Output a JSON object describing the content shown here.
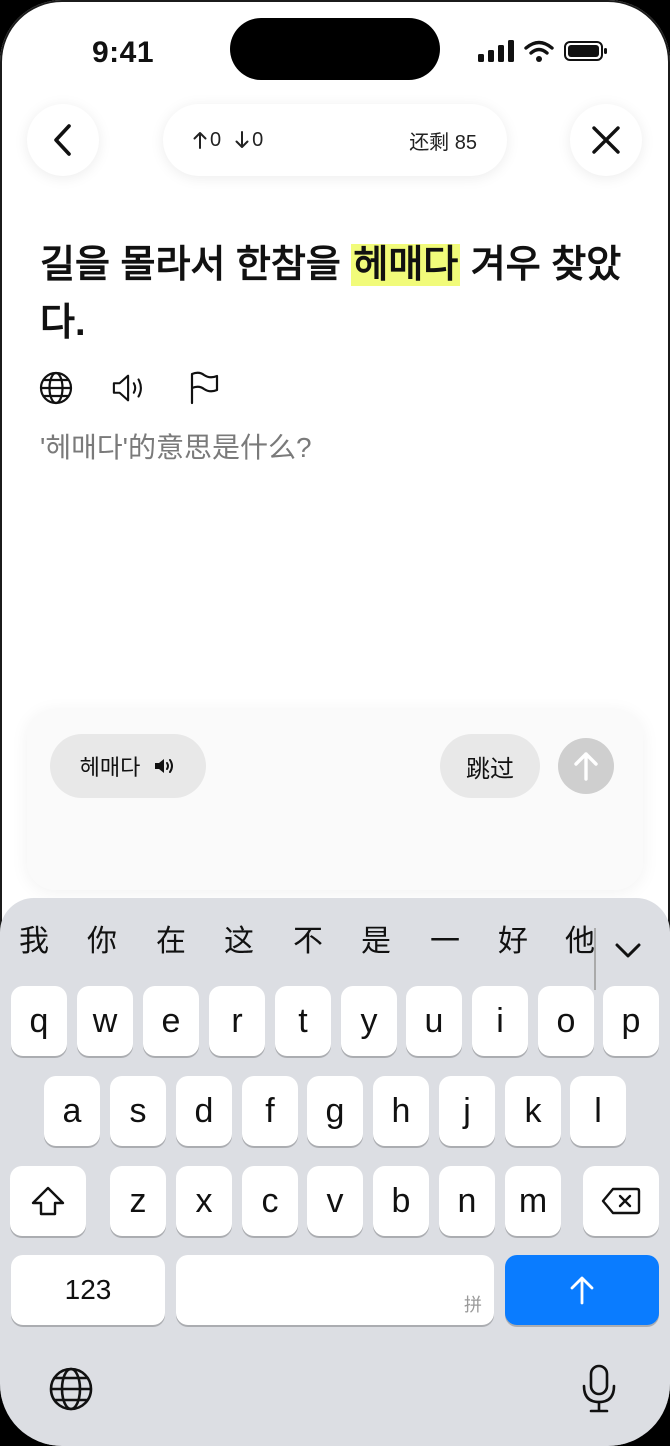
{
  "status_bar": {
    "time": "9:41"
  },
  "nav": {
    "back_icon": "chevron-left-icon",
    "close_icon": "close-icon",
    "up_count": "0",
    "down_count": "0",
    "remaining_label": "还剩 85"
  },
  "sentence": {
    "before": "길을 몰라서 한참을 ",
    "highlight": "헤매다",
    "after": " 겨우 찾았다."
  },
  "tools": [
    "globe-icon",
    "speaker-icon",
    "flag-icon"
  ],
  "question": "'헤매다'的意思是什么?",
  "answer_card": {
    "word_chip": "헤매다",
    "skip_label": "跳过"
  },
  "keyboard": {
    "candidates": [
      "我",
      "你",
      "在",
      "这",
      "不",
      "是",
      "一",
      "好",
      "他"
    ],
    "row1": [
      "q",
      "w",
      "e",
      "r",
      "t",
      "y",
      "u",
      "i",
      "o",
      "p"
    ],
    "row2": [
      "a",
      "s",
      "d",
      "f",
      "g",
      "h",
      "j",
      "k",
      "l"
    ],
    "row3": [
      "z",
      "x",
      "c",
      "v",
      "b",
      "n",
      "m"
    ],
    "num_label": "123",
    "space_hint": "拼",
    "accent_color": "#0a7cff"
  }
}
